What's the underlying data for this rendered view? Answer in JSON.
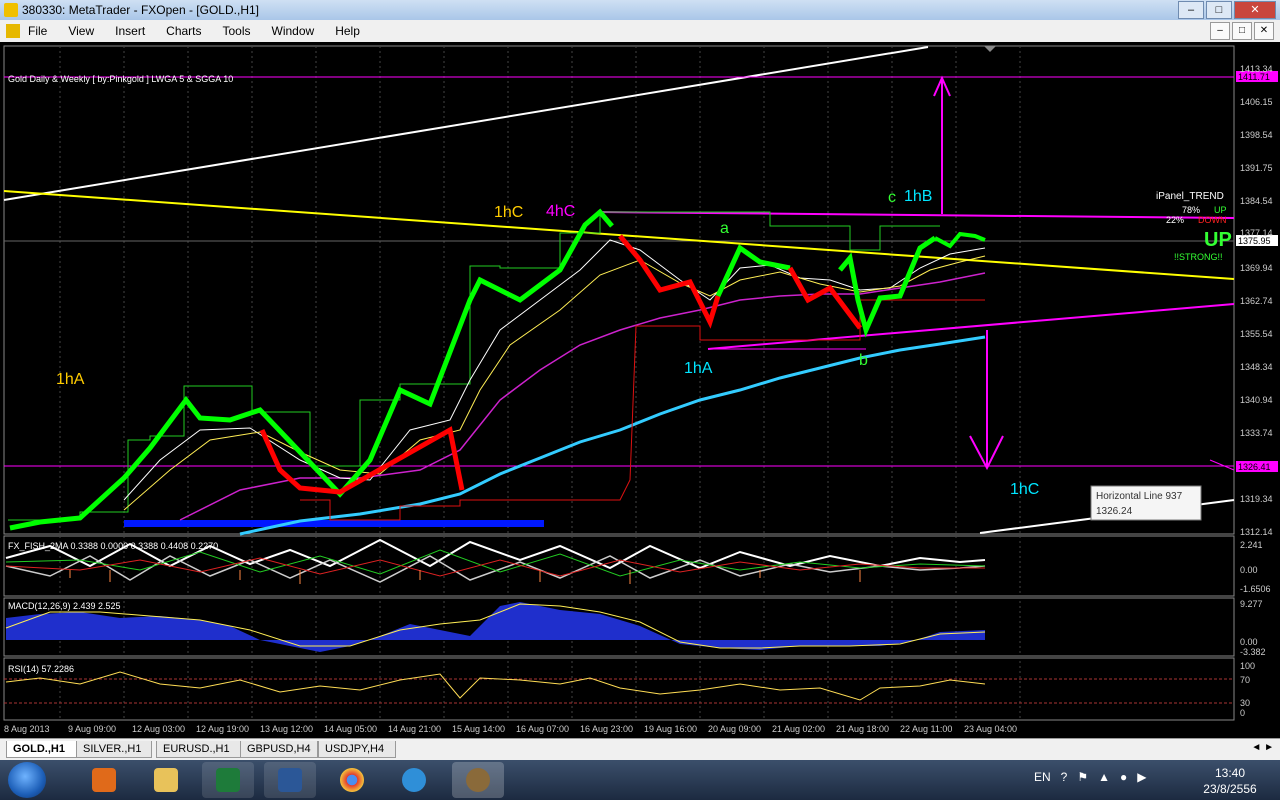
{
  "window": {
    "title": "380330: MetaTrader - FXOpen - [GOLD.,H1]",
    "minimize": "–",
    "maximize": "□",
    "close": "✕"
  },
  "menu": {
    "items": [
      "File",
      "View",
      "Insert",
      "Charts",
      "Tools",
      "Window",
      "Help"
    ],
    "mdi_buttons": [
      "–",
      "□",
      "✕"
    ]
  },
  "chart": {
    "indicator_label": "Gold Daily & Weekly [ by:Pinkgold ]  LWGA 5  &  SGGA 10",
    "price_axis": [
      "1413.34",
      "1406.15",
      "1398.54",
      "1391.75",
      "1384.54",
      "1377.14",
      "1369.94",
      "1362.74",
      "1355.54",
      "1348.34",
      "1340.94",
      "1333.74",
      "1326.41",
      "1319.34",
      "1312.14"
    ],
    "price_tags": [
      {
        "text": "1411.71",
        "color": "#ff00ff"
      },
      {
        "text": "1375.95",
        "color": "#ffffff"
      },
      {
        "text": "1326.41",
        "color": "#ff00ff"
      }
    ],
    "time_axis": [
      "8 Aug 2013",
      "9 Aug 09:00",
      "12 Aug 03:00",
      "12 Aug 19:00",
      "13 Aug 12:00",
      "14 Aug 05:00",
      "14 Aug 21:00",
      "15 Aug 14:00",
      "16 Aug 07:00",
      "16 Aug 23:00",
      "19 Aug 16:00",
      "20 Aug 09:00",
      "21 Aug 02:00",
      "21 Aug 18:00",
      "22 Aug 11:00",
      "23 Aug 04:00"
    ],
    "wave_labels": [
      {
        "text": "1hA",
        "color": "#ffcc00"
      },
      {
        "text": "1hC",
        "color": "#ffcc00"
      },
      {
        "text": "4hC",
        "color": "#ff00ff"
      },
      {
        "text": "a",
        "color": "#33ff33"
      },
      {
        "text": "c",
        "color": "#33ff33"
      },
      {
        "text": "1hB",
        "color": "#00e5ff"
      },
      {
        "text": "1hA",
        "color": "#00e5ff"
      },
      {
        "text": "b",
        "color": "#33ff33"
      },
      {
        "text": "1hC",
        "color": "#00e5ff"
      }
    ],
    "ipanel": {
      "title": "iPanel_TREND",
      "up_pct": "78%",
      "up_label": "UP",
      "down_pct": "22%",
      "down_label": "DOWN",
      "big_label": "UP",
      "strong_label": "!!STRONG!!"
    },
    "tooltip": {
      "name": "Horizontal Line 937",
      "value": "1326.24"
    },
    "fisher": {
      "label": "FX_FISH_2MA 0.3388 0.0000 0.3388 0.4408 0.2270",
      "axis": [
        "2.241",
        "0.00",
        "-1.6506"
      ]
    },
    "macd": {
      "label": "MACD(12,26,9) 2.439 2.525",
      "axis": [
        "9.277",
        "0.00",
        "-3.382"
      ]
    },
    "rsi": {
      "label": "RSI(14) 57.2286",
      "axis": [
        "100",
        "70",
        "30",
        "0"
      ]
    },
    "colors": {
      "up_candle": "#00ff00",
      "down_candle": "#ff0000",
      "yellow": "#ffff00",
      "magenta": "#ff00ff",
      "cyan": "#33ccff",
      "white": "#ffffff",
      "macd": "#1f2fcc"
    }
  },
  "symbol_tabs": [
    "GOLD.,H1",
    "SILVER.,H1",
    "EURUSD.,H1",
    "GBPUSD,H4",
    "USDJPY,H4"
  ],
  "tab_nav": "◄ ►",
  "taskbar": {
    "tray_lang": "EN",
    "tray_icons": [
      "?",
      "⚑",
      "▲",
      "●",
      "▶"
    ],
    "clock_time": "13:40",
    "clock_date": "23/8/2556"
  }
}
